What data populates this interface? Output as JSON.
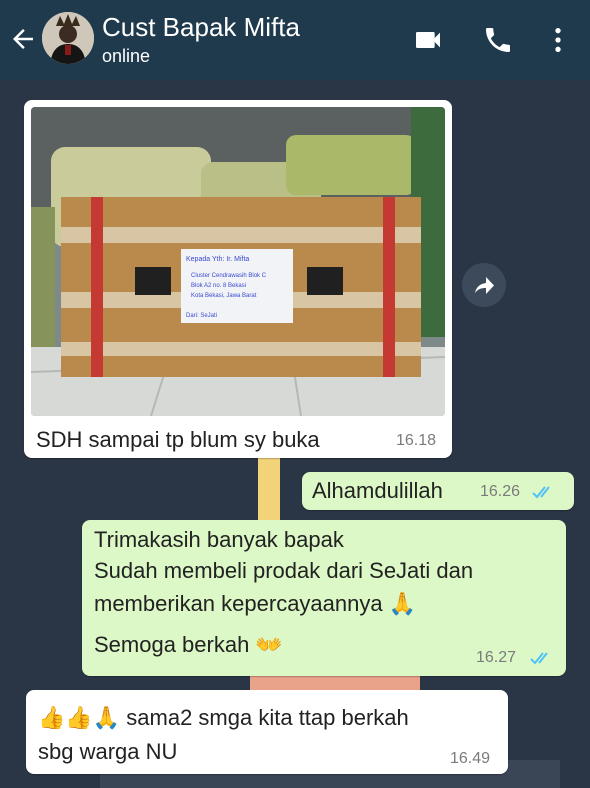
{
  "header": {
    "title": "Cust Bapak Mifta",
    "status": "online",
    "back_icon": "arrow-left-icon",
    "video_icon": "video-call-icon",
    "call_icon": "phone-icon",
    "menu_icon": "more-vert-icon"
  },
  "messages": [
    {
      "direction": "in",
      "type": "image",
      "text": "SDH sampai tp blum sy buka",
      "time": "16.18"
    },
    {
      "direction": "out",
      "text": "Alhamdulillah",
      "time": "16.26",
      "status": "read"
    },
    {
      "direction": "out",
      "lines": [
        "Trimakasih banyak bapak",
        "Sudah membeli prodak dari SeJati dan",
        "memberikan kepercayaannya 🙏",
        "Semoga berkah 👐"
      ],
      "time": "16.27",
      "status": "read"
    },
    {
      "direction": "in",
      "lines": [
        "👍👍🙏 sama2 smga kita ttap berkah",
        "sbg warga NU"
      ],
      "time": "16.49"
    }
  ],
  "photo_label": {
    "heading": "Kepada Yth: Ir. Mifta",
    "line1": "Cluster Cendrawasih Blok C",
    "line2": "Blok A2 no. 8 Bekasi",
    "line3": "Kota Bekasi, Jawa Barat",
    "from": "Dari: SeJati"
  },
  "colors": {
    "header": "#1f3a4d",
    "incoming": "#ffffff",
    "outgoing": "#dcf8c6",
    "read_tick": "#4fc3f7"
  }
}
